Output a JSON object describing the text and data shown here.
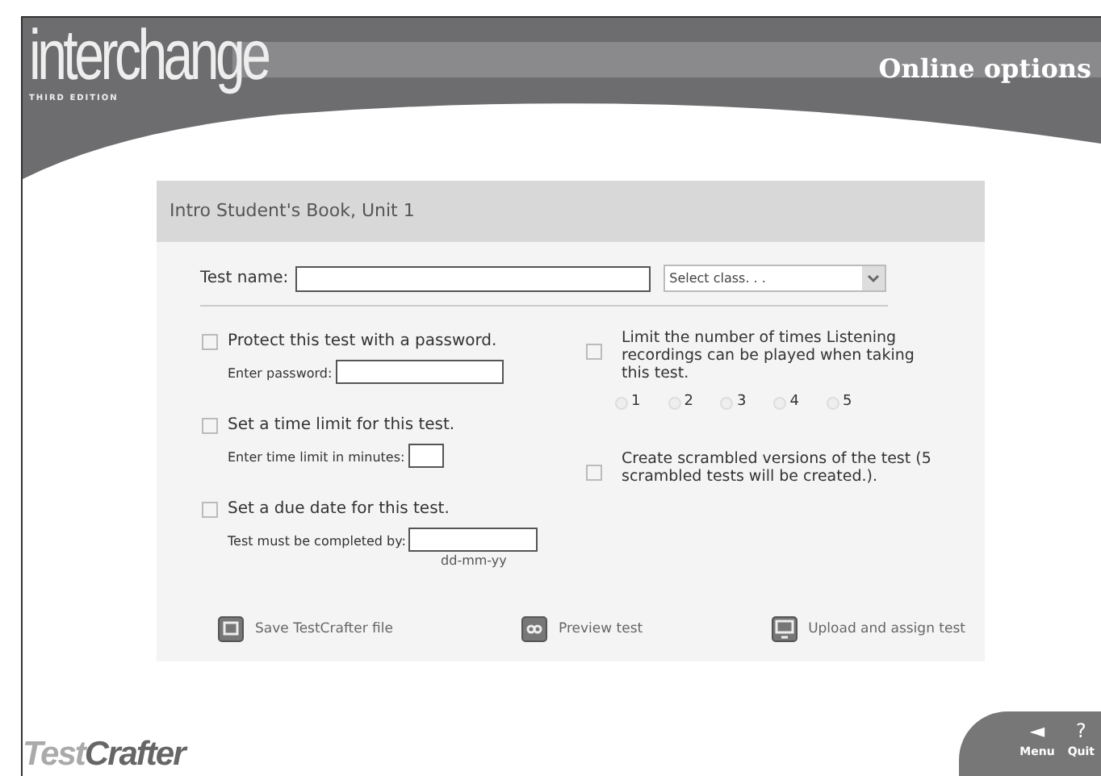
{
  "header": {
    "logo": "interchange",
    "logo_subtitle": "THIRD EDITION",
    "title": "Online options"
  },
  "panel": {
    "title": "Intro Student's Book, Unit 1",
    "test_name_label": "Test name:",
    "class_select": {
      "placeholder": "Select class. . ."
    },
    "left_options": [
      {
        "label": "Protect this test with a password.",
        "checked": false,
        "field_label": "Enter password:",
        "kind": "text"
      },
      {
        "label": "Set a time limit for this test.",
        "checked": false,
        "field_label": "Enter time limit in minutes:",
        "kind": "number"
      },
      {
        "label": "Set a due date for this test.",
        "checked": false,
        "field_label": "Test must be completed by:",
        "kind": "date",
        "hint": "dd-mm-yy"
      }
    ],
    "right_options": [
      {
        "label": "Limit the number of times Listening recordings can be played when taking this test.",
        "checked": false,
        "choices": [
          {
            "label": "1",
            "selected": false
          },
          {
            "label": "2",
            "selected": false
          },
          {
            "label": "3",
            "selected": false
          },
          {
            "label": "4",
            "selected": false
          },
          {
            "label": "5",
            "selected": false
          }
        ]
      },
      {
        "label": "Create scrambled versions of the test (5 scrambled tests will be created.).",
        "checked": false
      }
    ],
    "actions": [
      {
        "label": "Save TestCrafter file",
        "kind": "save"
      },
      {
        "label": "Preview test",
        "kind": "preview"
      },
      {
        "label": "Upload and assign test",
        "kind": "upload"
      }
    ]
  },
  "footer": {
    "brand_parts": [
      "Test",
      "Crafter"
    ],
    "nav": [
      {
        "symbol": "◄",
        "label": "Menu"
      },
      {
        "symbol": "?",
        "label": "Quit"
      }
    ]
  }
}
